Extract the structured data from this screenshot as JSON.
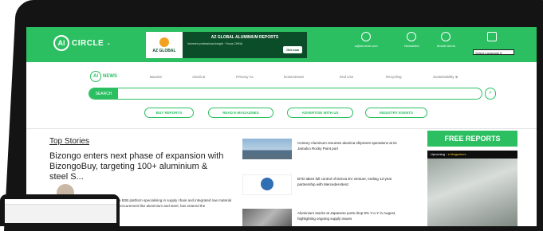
{
  "header": {
    "logo_mark": "Al",
    "logo_text": "CIRCLE",
    "caret": "⌄",
    "banner": {
      "brand": "AZ GLOBAL",
      "title": "AZ GLOBAL ALUMINIUM REPORTS",
      "subtitle": "Informed professional insight · Focus CHINA",
      "button": "Get now"
    },
    "icons": [
      {
        "name": "account",
        "label": "a@aircircle.com"
      },
      {
        "name": "newsletter",
        "label": "Newsletter"
      },
      {
        "name": "mobile-alerts",
        "label": "Mobile Alerts"
      },
      {
        "name": "language",
        "label": ""
      }
    ],
    "language_select": "Select Language ▾"
  },
  "news_nav": {
    "logo_mark": "Al",
    "logo_text": "NEWS",
    "items": [
      "Bauxite",
      "Alumina",
      "Primary AL",
      "Downstream",
      "End Use",
      "Recycling",
      "Sustainability ⊕"
    ]
  },
  "search": {
    "label": "SEARCH",
    "placeholder": "",
    "button": "⌕"
  },
  "pills": [
    "BUY REPORTS",
    "READ E-MAGAZINES",
    "ADVERTISE WITH US",
    "INDUSTRY EVENTS"
  ],
  "top_stories": {
    "heading": "Top Stories",
    "headline": "Bizongo enters next phase of expansion with BizongoBuy, targeting 100+ aluminium & steel S...",
    "excerpt": "a B2B platform specialising in supply chain and integrated raw material procurement like aluminium and steel, has entered the"
  },
  "stories": [
    {
      "text": "Century Aluminum resumes alumina shipment operations at its Jamalco Rocky Point port"
    },
    {
      "text": "BYD takes full control of Denza EV venture, ending 13-year partnership with Mercedes-Benz"
    },
    {
      "text": "Aluminium stocks at Japanese ports drop 9% Y-o-Y in August, highlighting ongoing supply issues"
    }
  ],
  "sidebar": {
    "free_reports": "FREE REPORTS",
    "upcoming": "Upcoming",
    "upcoming_highlight": "e-Magazines"
  },
  "colors": {
    "accent": "#2bbf61",
    "banner": "#0b4d28",
    "bezel": "#141414"
  }
}
